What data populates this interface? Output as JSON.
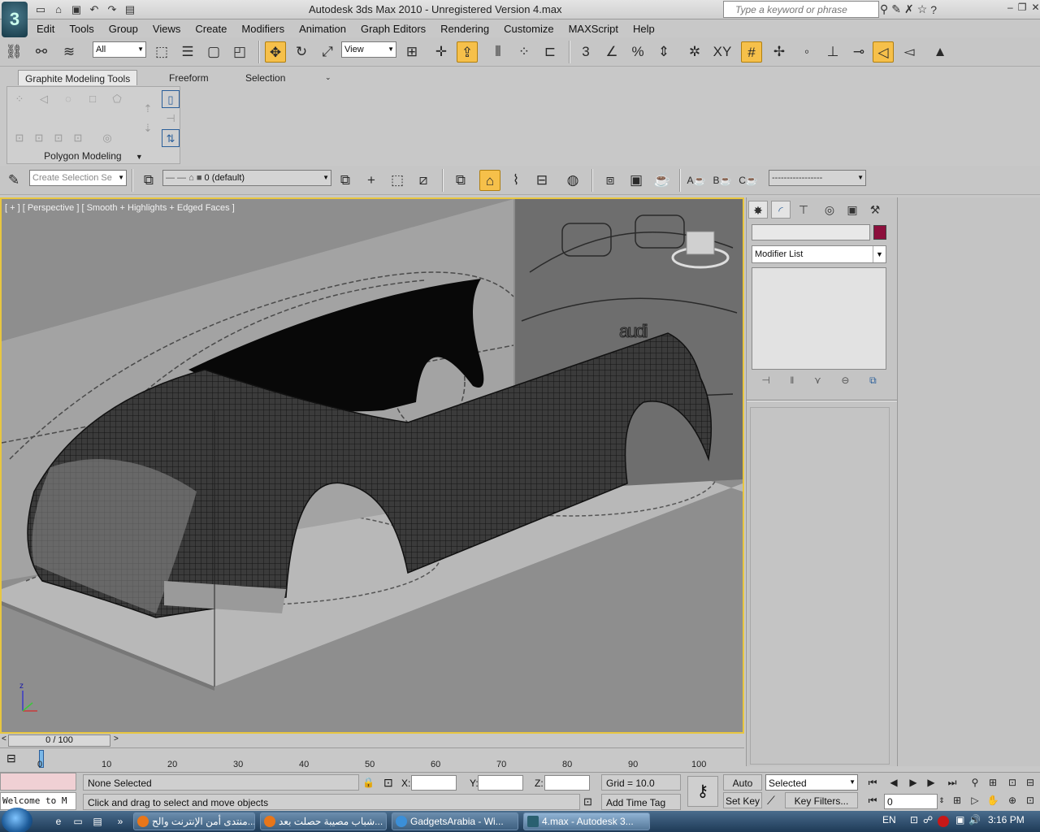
{
  "app": {
    "logo_label": "3",
    "title": "Autodesk 3ds Max  2010   - Unregistered Version     4.max",
    "search_placeholder": "Type a keyword or phrase"
  },
  "menus": [
    "Edit",
    "Tools",
    "Group",
    "Views",
    "Create",
    "Modifiers",
    "Animation",
    "Graph Editors",
    "Rendering",
    "Customize",
    "MAXScript",
    "Help"
  ],
  "main_toolbar": {
    "selection_filter": "All",
    "reference_coord": "View"
  },
  "ribbon": {
    "tabs": [
      "Graphite Modeling Tools",
      "Freeform",
      "Selection"
    ],
    "active_tab": "Graphite Modeling Tools",
    "panel_title": "Polygon Modeling"
  },
  "layer_toolbar": {
    "selection_set_placeholder": "Create Selection Se",
    "layer": "0 (default)",
    "abc_labels": [
      "A",
      "B",
      "C"
    ]
  },
  "viewport": {
    "label": "[ + ] [ Perspective ] [ Smooth + Highlights + Edged Faces ]",
    "background_text": "audi",
    "axis_label": "z"
  },
  "command_panel": {
    "modifier_list": "Modifier List",
    "object_color": "#8c0f3c"
  },
  "timeline": {
    "frame_indicator": "0 / 100",
    "ticks": [
      "0",
      "10",
      "20",
      "30",
      "40",
      "50",
      "60",
      "70",
      "80",
      "90",
      "100"
    ]
  },
  "status": {
    "maxscript_text": "Welcome to M",
    "selection_status": "None Selected",
    "prompt": "Click and drag to select and move objects",
    "x_label": "X:",
    "y_label": "Y:",
    "z_label": "Z:",
    "grid": "Grid = 10.0",
    "add_time_tag": "Add Time Tag",
    "auto_key": "Auto Key",
    "set_key": "Set Key",
    "key_mode": "Selected",
    "key_filters": "Key Filters...",
    "current_frame": "0"
  },
  "taskbar": {
    "buttons": [
      "منتدى أمن الإنترنت والح...",
      "شباب مصيبة حصلت بعد...",
      "GadgetsArabia - Wi...",
      "4.max - Autodesk 3..."
    ],
    "language": "EN",
    "time": "3:16 PM"
  }
}
